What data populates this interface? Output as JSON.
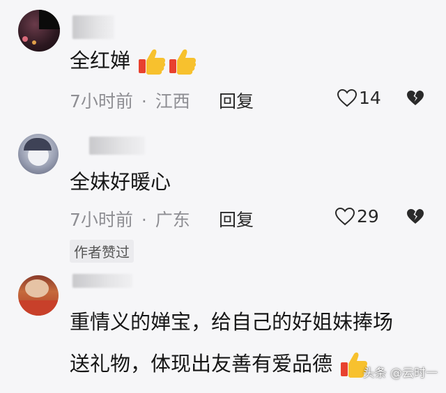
{
  "comments": [
    {
      "text": "全红婵",
      "time": "7小时前",
      "location": "江西",
      "reply_label": "回复",
      "likes": "14",
      "emoji_count": 2,
      "author_liked": false
    },
    {
      "text": "全妹好暖心",
      "time": "7小时前",
      "location": "广东",
      "reply_label": "回复",
      "likes": "29",
      "emoji_count": 0,
      "author_liked": true,
      "author_badge": "作者赞过"
    },
    {
      "text_line1": "重情义的婵宝，给自己的好姐妹捧场",
      "text_line2": "送礼物，体现出友善有爱品德",
      "emoji_count": 1
    }
  ],
  "meta_separator": "·",
  "watermark": "头条 @云时一",
  "colors": {
    "background": "#f6f6f8",
    "meta_text": "#8e8e93",
    "thumb_yellow": "#f7c12e",
    "thumb_red": "#e8412f"
  },
  "icons": {
    "like": "heart-outline-icon",
    "dislike": "broken-heart-icon",
    "emoji": "thumbs-up-emoji"
  }
}
